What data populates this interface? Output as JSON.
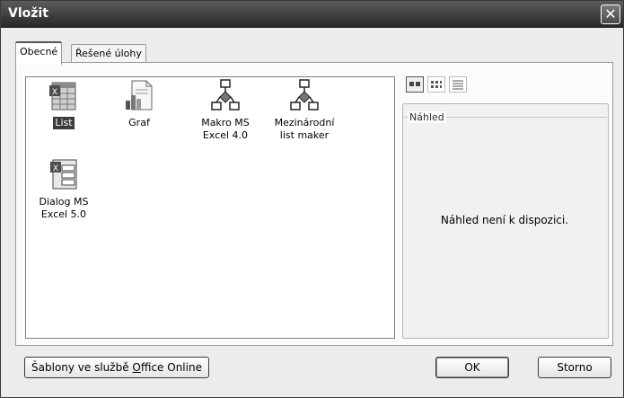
{
  "window": {
    "title": "Vložit",
    "close_glyph": "✕"
  },
  "tabs": [
    {
      "label": "Obecné",
      "active": true
    },
    {
      "label": "Řešené úlohy",
      "active": false
    }
  ],
  "items": [
    {
      "label": "List",
      "icon": "worksheet-icon",
      "selected": true
    },
    {
      "label": "Graf",
      "icon": "chart-icon",
      "selected": false
    },
    {
      "label": "Makro MS Excel 4.0",
      "icon": "macro-icon",
      "selected": false
    },
    {
      "label": "Mezinárodní list maker",
      "icon": "macro-icon",
      "selected": false
    },
    {
      "label": "Dialog MS Excel 5.0",
      "icon": "dialog-sheet-icon",
      "selected": false
    }
  ],
  "view_buttons": [
    "large-icons-view-icon",
    "list-view-icon",
    "details-view-icon"
  ],
  "preview": {
    "legend": "Náhled",
    "empty_text": "Náhled není k dispozici."
  },
  "buttons": {
    "templates_prefix": "Šablony ve službě ",
    "templates_accel": "O",
    "templates_suffix": "ffice Online",
    "ok": "OK",
    "cancel": "Storno"
  }
}
